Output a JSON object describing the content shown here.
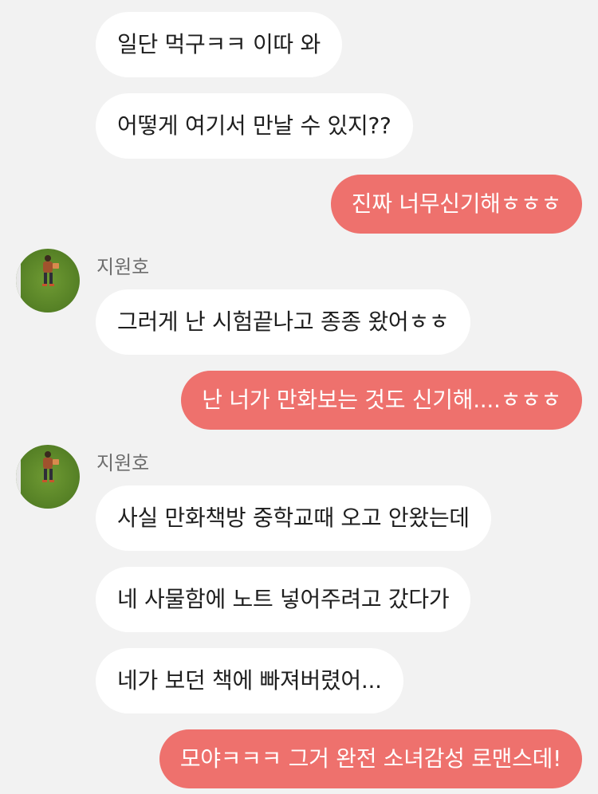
{
  "conversation": {
    "messages": [
      {
        "text": "일단 먹구ㅋㅋ 이따 와",
        "direction": "incoming"
      },
      {
        "text": "어떻게 여기서 만날 수 있지??",
        "direction": "incoming"
      },
      {
        "text": "진짜 너무신기해ㅎㅎㅎ",
        "direction": "outgoing"
      },
      {
        "text": "그러게 난 시험끝나고 종종 왔어ㅎㅎ",
        "direction": "incoming",
        "sender": "지원호"
      },
      {
        "text": "난 너가 만화보는 것도 신기해....ㅎㅎㅎ",
        "direction": "outgoing"
      },
      {
        "text": "사실 만화책방 중학교때 오고 안왔는데",
        "direction": "incoming",
        "sender": "지원호"
      },
      {
        "text": "네 사물함에 노트 넣어주려고 갔다가",
        "direction": "incoming"
      },
      {
        "text": "네가 보던 책에 빠져버렸어...",
        "direction": "incoming"
      },
      {
        "text": "모야ㅋㅋㅋ 그거 완전 소녀감성 로맨스데!",
        "direction": "outgoing"
      }
    ],
    "contact": {
      "name": "지원호",
      "avatar_icon": "avatar-photo-person-on-grass"
    }
  },
  "colors": {
    "background": "#f2f2f2",
    "incoming_bubble": "#ffffff",
    "outgoing_bubble": "#ee716d",
    "incoming_text": "#1e1e1e",
    "outgoing_text": "#ffffff",
    "sender_name": "#6e6e6e"
  }
}
